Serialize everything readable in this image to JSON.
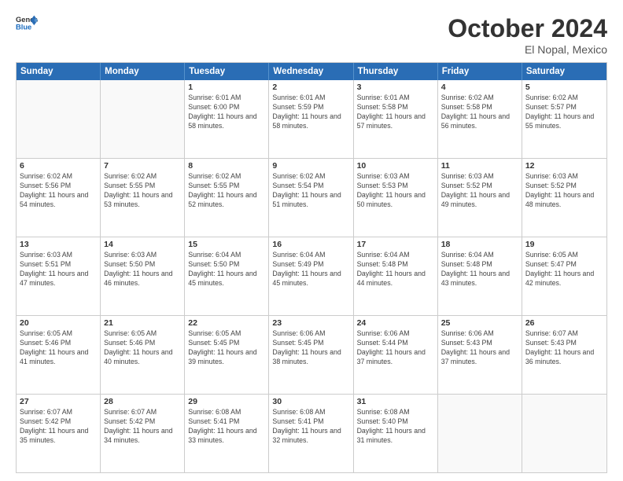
{
  "header": {
    "logo_general": "General",
    "logo_blue": "Blue",
    "title": "October 2024",
    "location": "El Nopal, Mexico"
  },
  "days": [
    "Sunday",
    "Monday",
    "Tuesday",
    "Wednesday",
    "Thursday",
    "Friday",
    "Saturday"
  ],
  "weeks": [
    [
      {
        "date": "",
        "info": ""
      },
      {
        "date": "",
        "info": ""
      },
      {
        "date": "1",
        "info": "Sunrise: 6:01 AM\nSunset: 6:00 PM\nDaylight: 11 hours and 58 minutes."
      },
      {
        "date": "2",
        "info": "Sunrise: 6:01 AM\nSunset: 5:59 PM\nDaylight: 11 hours and 58 minutes."
      },
      {
        "date": "3",
        "info": "Sunrise: 6:01 AM\nSunset: 5:58 PM\nDaylight: 11 hours and 57 minutes."
      },
      {
        "date": "4",
        "info": "Sunrise: 6:02 AM\nSunset: 5:58 PM\nDaylight: 11 hours and 56 minutes."
      },
      {
        "date": "5",
        "info": "Sunrise: 6:02 AM\nSunset: 5:57 PM\nDaylight: 11 hours and 55 minutes."
      }
    ],
    [
      {
        "date": "6",
        "info": "Sunrise: 6:02 AM\nSunset: 5:56 PM\nDaylight: 11 hours and 54 minutes."
      },
      {
        "date": "7",
        "info": "Sunrise: 6:02 AM\nSunset: 5:55 PM\nDaylight: 11 hours and 53 minutes."
      },
      {
        "date": "8",
        "info": "Sunrise: 6:02 AM\nSunset: 5:55 PM\nDaylight: 11 hours and 52 minutes."
      },
      {
        "date": "9",
        "info": "Sunrise: 6:02 AM\nSunset: 5:54 PM\nDaylight: 11 hours and 51 minutes."
      },
      {
        "date": "10",
        "info": "Sunrise: 6:03 AM\nSunset: 5:53 PM\nDaylight: 11 hours and 50 minutes."
      },
      {
        "date": "11",
        "info": "Sunrise: 6:03 AM\nSunset: 5:52 PM\nDaylight: 11 hours and 49 minutes."
      },
      {
        "date": "12",
        "info": "Sunrise: 6:03 AM\nSunset: 5:52 PM\nDaylight: 11 hours and 48 minutes."
      }
    ],
    [
      {
        "date": "13",
        "info": "Sunrise: 6:03 AM\nSunset: 5:51 PM\nDaylight: 11 hours and 47 minutes."
      },
      {
        "date": "14",
        "info": "Sunrise: 6:03 AM\nSunset: 5:50 PM\nDaylight: 11 hours and 46 minutes."
      },
      {
        "date": "15",
        "info": "Sunrise: 6:04 AM\nSunset: 5:50 PM\nDaylight: 11 hours and 45 minutes."
      },
      {
        "date": "16",
        "info": "Sunrise: 6:04 AM\nSunset: 5:49 PM\nDaylight: 11 hours and 45 minutes."
      },
      {
        "date": "17",
        "info": "Sunrise: 6:04 AM\nSunset: 5:48 PM\nDaylight: 11 hours and 44 minutes."
      },
      {
        "date": "18",
        "info": "Sunrise: 6:04 AM\nSunset: 5:48 PM\nDaylight: 11 hours and 43 minutes."
      },
      {
        "date": "19",
        "info": "Sunrise: 6:05 AM\nSunset: 5:47 PM\nDaylight: 11 hours and 42 minutes."
      }
    ],
    [
      {
        "date": "20",
        "info": "Sunrise: 6:05 AM\nSunset: 5:46 PM\nDaylight: 11 hours and 41 minutes."
      },
      {
        "date": "21",
        "info": "Sunrise: 6:05 AM\nSunset: 5:46 PM\nDaylight: 11 hours and 40 minutes."
      },
      {
        "date": "22",
        "info": "Sunrise: 6:05 AM\nSunset: 5:45 PM\nDaylight: 11 hours and 39 minutes."
      },
      {
        "date": "23",
        "info": "Sunrise: 6:06 AM\nSunset: 5:45 PM\nDaylight: 11 hours and 38 minutes."
      },
      {
        "date": "24",
        "info": "Sunrise: 6:06 AM\nSunset: 5:44 PM\nDaylight: 11 hours and 37 minutes."
      },
      {
        "date": "25",
        "info": "Sunrise: 6:06 AM\nSunset: 5:43 PM\nDaylight: 11 hours and 37 minutes."
      },
      {
        "date": "26",
        "info": "Sunrise: 6:07 AM\nSunset: 5:43 PM\nDaylight: 11 hours and 36 minutes."
      }
    ],
    [
      {
        "date": "27",
        "info": "Sunrise: 6:07 AM\nSunset: 5:42 PM\nDaylight: 11 hours and 35 minutes."
      },
      {
        "date": "28",
        "info": "Sunrise: 6:07 AM\nSunset: 5:42 PM\nDaylight: 11 hours and 34 minutes."
      },
      {
        "date": "29",
        "info": "Sunrise: 6:08 AM\nSunset: 5:41 PM\nDaylight: 11 hours and 33 minutes."
      },
      {
        "date": "30",
        "info": "Sunrise: 6:08 AM\nSunset: 5:41 PM\nDaylight: 11 hours and 32 minutes."
      },
      {
        "date": "31",
        "info": "Sunrise: 6:08 AM\nSunset: 5:40 PM\nDaylight: 11 hours and 31 minutes."
      },
      {
        "date": "",
        "info": ""
      },
      {
        "date": "",
        "info": ""
      }
    ]
  ]
}
